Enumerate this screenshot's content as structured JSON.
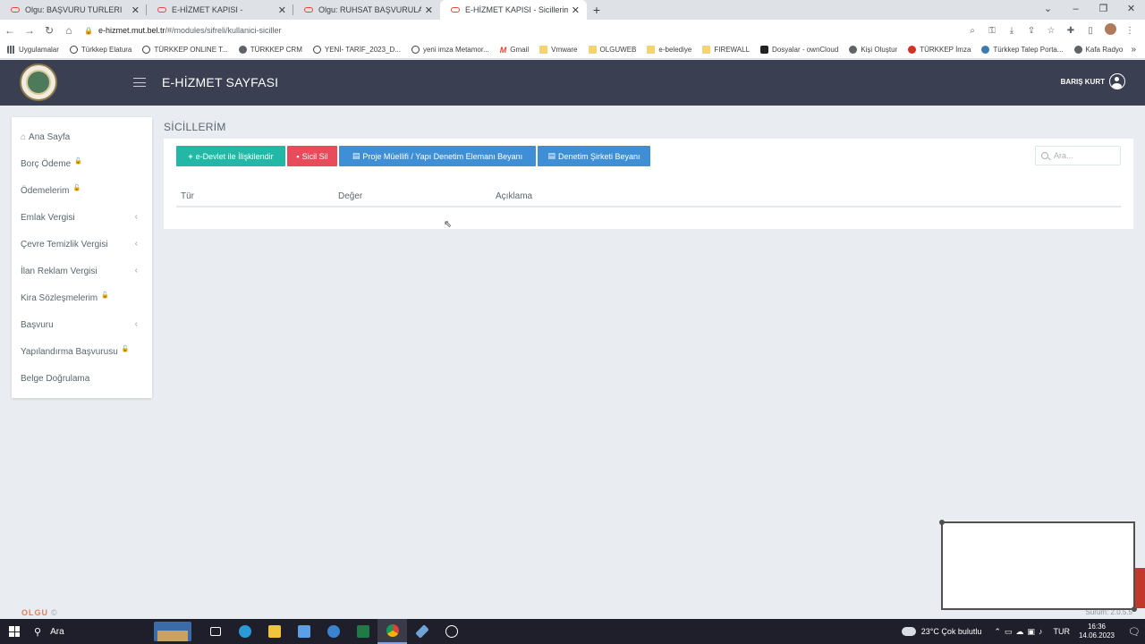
{
  "browser": {
    "tabs": [
      {
        "label": "Olgu: BAŞVURU TURLERI",
        "active": false
      },
      {
        "label": "E-HİZMET KAPISI -",
        "active": false
      },
      {
        "label": "Olgu: RUHSAT BAŞVURULARI",
        "active": false
      },
      {
        "label": "E-HİZMET KAPISI - Sicillerim",
        "active": true
      }
    ],
    "new_tab": "+",
    "url_host": "e-hizmet.mut.bel.tr",
    "url_path": "/#/modules/sifreli/kullanici-siciller",
    "bookmarks": [
      {
        "label": "Uygulamalar",
        "icon": "grid-icon"
      },
      {
        "label": "Türkkep Elatura",
        "icon": "globe-icon"
      },
      {
        "label": "TÜRKKEP ONLINE T...",
        "icon": "globe-icon"
      },
      {
        "label": "TÜRKKEP CRM",
        "icon": "people-icon"
      },
      {
        "label": "YENİ- TARİF_2023_D...",
        "icon": "globe-icon"
      },
      {
        "label": "yeni imza Metamor...",
        "icon": "globe-icon"
      },
      {
        "label": "Gmail",
        "icon": "gmail-icon"
      },
      {
        "label": "Vmware",
        "icon": "folder-icon"
      },
      {
        "label": "OLGUWEB",
        "icon": "folder-icon"
      },
      {
        "label": "e-belediye",
        "icon": "folder-icon"
      },
      {
        "label": "FIREWALL",
        "icon": "folder-icon"
      },
      {
        "label": "Dosyalar - ownCloud",
        "icon": "cloud-icon"
      },
      {
        "label": "Kişi Oluştur",
        "icon": "people-icon"
      },
      {
        "label": "TÜRKKEP İmza",
        "icon": "turkkep-icon"
      },
      {
        "label": "Türkkep Talep Porta...",
        "icon": "wordpress-icon"
      },
      {
        "label": "Kafa Radyo",
        "icon": "people-icon"
      }
    ],
    "bookmarks_more": "»"
  },
  "header": {
    "title": "E-HİZMET SAYFASI",
    "user_name": "BARIŞ KURT"
  },
  "sidebar": {
    "items": [
      {
        "label": "Ana Sayfa",
        "lock": false,
        "expandable": false,
        "home": true
      },
      {
        "label": "Borç Ödeme",
        "lock": true,
        "expandable": false
      },
      {
        "label": "Ödemelerim",
        "lock": true,
        "expandable": false
      },
      {
        "label": "Emlak Vergisi",
        "lock": false,
        "expandable": true
      },
      {
        "label": "Çevre Temizlik Vergisi",
        "lock": false,
        "expandable": true
      },
      {
        "label": "İlan Reklam Vergisi",
        "lock": false,
        "expandable": true
      },
      {
        "label": "Kira Sözleşmelerim",
        "lock": true,
        "expandable": false
      },
      {
        "label": "Başvuru",
        "lock": false,
        "expandable": true
      },
      {
        "label": "Yapılandırma Başvurusu",
        "lock": true,
        "expandable": false
      },
      {
        "label": "Belge Doğrulama",
        "lock": false,
        "expandable": false
      }
    ]
  },
  "main": {
    "page_title": "SİCİLLERİM",
    "buttons": {
      "link_edevlet": "e-Devlet ile İlişkilendir",
      "delete_registry": "Sicil Sil",
      "project_owner_declaration": "Proje Müellifi / Yapı Denetim Elemanı Beyanı",
      "inspection_company_declaration": "Denetim Şirketi Beyanı"
    },
    "search_placeholder": "Ara...",
    "table": {
      "columns": [
        "Tür",
        "Değer",
        "Açıklama"
      ]
    }
  },
  "footer": {
    "brand": "OLGU",
    "copyright": "©",
    "version": "Sürüm: 2.0.5.5"
  },
  "taskbar": {
    "search_label": "Ara",
    "weather": "23°C  Çok bulutlu",
    "language": "TUR",
    "time": "16:36",
    "date": "14.06.2023"
  },
  "colors": {
    "header_bg": "#3a3f51",
    "btn_green": "#23b7a5",
    "btn_red": "#e84c5b",
    "btn_blue": "#3f8fd6",
    "page_bg": "#e9edf2"
  }
}
